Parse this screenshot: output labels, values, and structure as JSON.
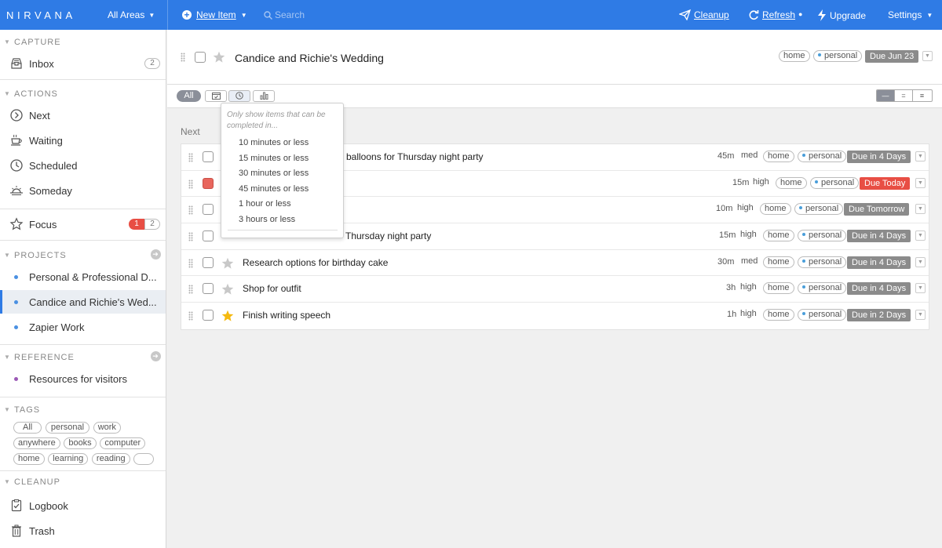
{
  "header": {
    "logo": "NIRVANA",
    "areas": "All Areas",
    "new_item": "New Item",
    "search_placeholder": "Search",
    "cleanup": "Cleanup",
    "refresh": "Refresh",
    "upgrade": "Upgrade",
    "settings": "Settings"
  },
  "sidebar": {
    "capture": {
      "title": "CAPTURE",
      "inbox": {
        "label": "Inbox",
        "count": "2"
      }
    },
    "actions": {
      "title": "ACTIONS",
      "next": "Next",
      "waiting": "Waiting",
      "scheduled": "Scheduled",
      "someday": "Someday"
    },
    "focus": {
      "label": "Focus",
      "count_red": "1",
      "count": "2"
    },
    "projects": {
      "title": "PROJECTS",
      "items": [
        {
          "label": "Personal & Professional D...",
          "color": "#4a90e2"
        },
        {
          "label": "Candice and Richie's Wed...",
          "color": "#4a90e2"
        },
        {
          "label": "Zapier Work",
          "color": "#4a90e2"
        }
      ]
    },
    "reference": {
      "title": "REFERENCE",
      "items": [
        {
          "label": "Resources for visitors",
          "color": "#9b59b6"
        }
      ]
    },
    "tags": {
      "title": "TAGS",
      "items": [
        "All",
        "personal",
        "work",
        "anywhere",
        "books",
        "computer",
        "home",
        "learning",
        "reading",
        ""
      ]
    },
    "cleanup": {
      "title": "CLEANUP",
      "logbook": "Logbook",
      "trash": "Trash"
    }
  },
  "project": {
    "title": "Candice and Richie's Wedding",
    "tags": [
      "home",
      "personal"
    ],
    "due": "Due Jun 23"
  },
  "filters": {
    "all": "All"
  },
  "section": "Next",
  "popup": {
    "hint": "Only show items that can be completed in...",
    "options": [
      "10 minutes or less",
      "15 minutes or less",
      "30 minutes or less",
      "45 minutes or less",
      "1 hour or less",
      "3 hours or less"
    ]
  },
  "tasks": [
    {
      "title": "balloons for Thursday night party",
      "est": "45m",
      "energy": "med",
      "tags": [
        "home",
        "personal"
      ],
      "due": "Due in 4 Days",
      "due_color": "grey",
      "checkbox": "empty",
      "star": "hidden"
    },
    {
      "title": "",
      "est": "15m",
      "energy": "high",
      "tags": [
        "home",
        "personal"
      ],
      "due": "Due Today",
      "due_color": "red",
      "checkbox": "red",
      "star": "hidden"
    },
    {
      "title": "",
      "est": "10m",
      "energy": "high",
      "tags": [
        "home",
        "personal"
      ],
      "due": "Due Tomorrow",
      "due_color": "grey",
      "checkbox": "empty",
      "star": "hidden"
    },
    {
      "title": "Thursday night party",
      "est": "15m",
      "energy": "high",
      "tags": [
        "home",
        "personal"
      ],
      "due": "Due in 4 Days",
      "due_color": "grey",
      "checkbox": "empty",
      "star": "hidden"
    },
    {
      "title": "Research options for birthday cake",
      "est": "30m",
      "energy": "med",
      "tags": [
        "home",
        "personal"
      ],
      "due": "Due in 4 Days",
      "due_color": "grey",
      "checkbox": "empty",
      "star": "grey"
    },
    {
      "title": "Shop for outfit",
      "est": "3h",
      "energy": "high",
      "tags": [
        "home",
        "personal"
      ],
      "due": "Due in 4 Days",
      "due_color": "grey",
      "checkbox": "empty",
      "star": "grey"
    },
    {
      "title": "Finish writing speech",
      "est": "1h",
      "energy": "high",
      "tags": [
        "home",
        "personal"
      ],
      "due": "Due in 2 Days",
      "due_color": "grey",
      "checkbox": "empty",
      "star": "gold"
    }
  ]
}
